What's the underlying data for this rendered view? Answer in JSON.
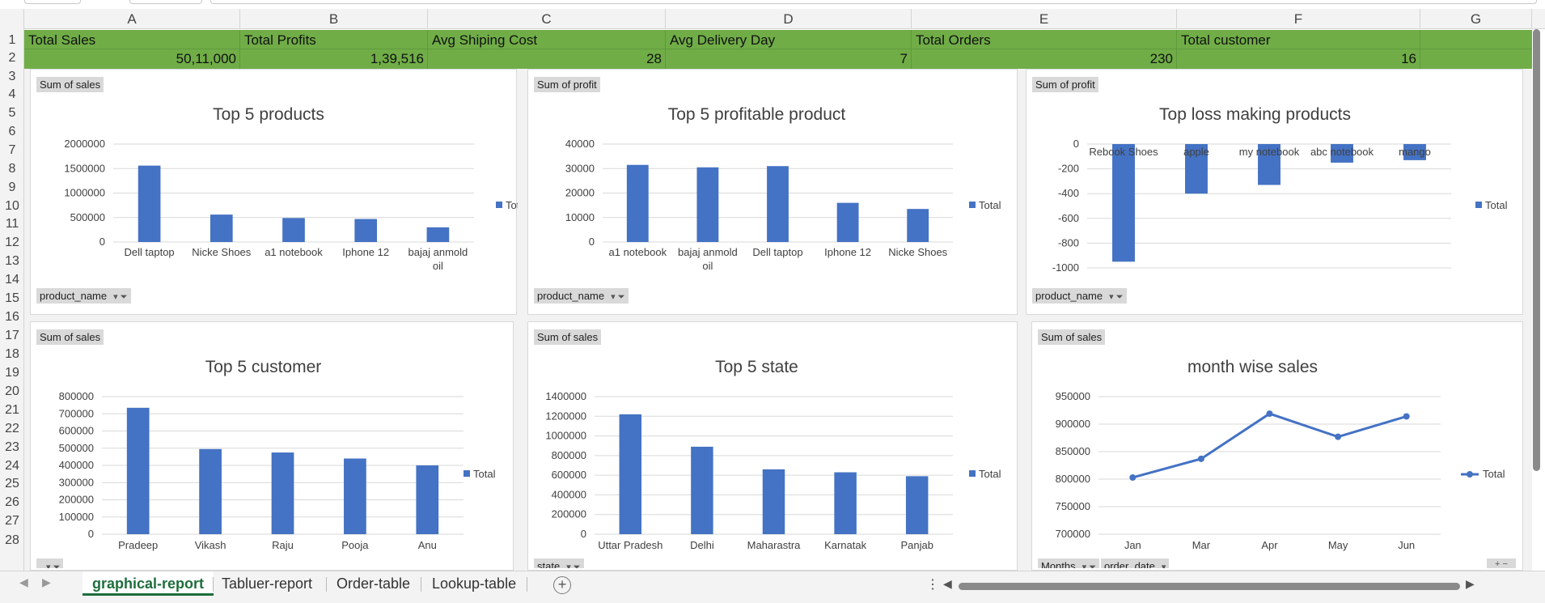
{
  "columns": [
    "A",
    "B",
    "C",
    "D",
    "E",
    "F",
    "G"
  ],
  "rows": [
    "1",
    "2",
    "3",
    "4",
    "5",
    "6",
    "7",
    "8",
    "9",
    "10",
    "11",
    "12",
    "13",
    "14",
    "15",
    "16",
    "17",
    "18",
    "19",
    "20",
    "21",
    "22",
    "23",
    "24",
    "25",
    "26",
    "27",
    "28"
  ],
  "kpis": [
    {
      "label": "Total Sales",
      "value": "50,11,000"
    },
    {
      "label": "Total Profits",
      "value": "1,39,516"
    },
    {
      "label": "Avg Shiping Cost",
      "value": "28"
    },
    {
      "label": "Avg Delivery Day",
      "value": "7"
    },
    {
      "label": "Total Orders",
      "value": "230"
    },
    {
      "label": "Total customer",
      "value": "16"
    }
  ],
  "chart_data": [
    {
      "type": "bar",
      "title": "Top 5 products",
      "field_tag": "Sum of sales",
      "filter_tag": "product_name",
      "legend": "Total",
      "categories": [
        "Dell taptop",
        "Nicke Shoes",
        "a1 notebook",
        "Iphone 12",
        "bajaj anmold oil"
      ],
      "values": [
        1560000,
        560000,
        490000,
        470000,
        300000
      ],
      "yticks": [
        "2000000",
        "1500000",
        "1000000",
        "500000",
        "0"
      ],
      "ylim": [
        0,
        2000000
      ]
    },
    {
      "type": "bar",
      "title": "Top 5 profitable product",
      "field_tag": "Sum of profit",
      "filter_tag": "product_name",
      "legend": "Total",
      "categories": [
        "a1 notebook",
        "bajaj anmold oil",
        "Dell taptop",
        "Iphone 12",
        "Nicke Shoes"
      ],
      "values": [
        31500,
        30500,
        31000,
        16000,
        13500
      ],
      "yticks": [
        "40000",
        "30000",
        "20000",
        "10000",
        "0"
      ],
      "ylim": [
        0,
        40000
      ]
    },
    {
      "type": "bar",
      "title": "Top loss making products",
      "field_tag": "Sum of profit",
      "filter_tag": "product_name",
      "legend": "Total",
      "categories": [
        "Rebook Shoes",
        "apple",
        "my notebook",
        "abc notebook",
        "mango"
      ],
      "values": [
        -950,
        -400,
        -330,
        -150,
        -130
      ],
      "yticks": [
        "0",
        "-200",
        "-400",
        "-600",
        "-800",
        "-1000"
      ],
      "ylim": [
        -1000,
        0
      ]
    },
    {
      "type": "bar",
      "title": "Top 5 customer",
      "field_tag": "Sum of sales",
      "filter_tag": "",
      "legend": "Total",
      "categories": [
        "Pradeep",
        "Vikash",
        "Raju",
        "Pooja",
        "Anu"
      ],
      "values": [
        735000,
        495000,
        475000,
        440000,
        400000
      ],
      "yticks": [
        "800000",
        "700000",
        "600000",
        "500000",
        "400000",
        "300000",
        "200000",
        "100000",
        "0"
      ],
      "ylim": [
        0,
        800000
      ]
    },
    {
      "type": "bar",
      "title": "Top 5 state",
      "field_tag": "Sum of sales",
      "filter_tag": "state",
      "legend": "Total",
      "categories": [
        "Uttar Pradesh",
        "Delhi",
        "Maharastra",
        "Karnatak",
        "Panjab"
      ],
      "values": [
        1220000,
        890000,
        660000,
        630000,
        590000
      ],
      "yticks": [
        "1400000",
        "1200000",
        "1000000",
        "800000",
        "600000",
        "400000",
        "200000",
        "0"
      ],
      "ylim": [
        0,
        1400000
      ]
    },
    {
      "type": "line",
      "title": "month wise sales",
      "field_tag": "Sum of sales",
      "filter_tag": "Months",
      "filter_tag2": "order_date",
      "legend": "Total",
      "categories": [
        "Jan",
        "Mar",
        "Apr",
        "May",
        "Jun"
      ],
      "values": [
        803000,
        837000,
        919000,
        877000,
        914000
      ],
      "yticks": [
        "950000",
        "900000",
        "850000",
        "800000",
        "750000",
        "700000"
      ],
      "ylim": [
        700000,
        950000
      ]
    }
  ],
  "tabs": [
    {
      "label": "graphical-report",
      "active": true
    },
    {
      "label": "Tabluer-report",
      "active": false
    },
    {
      "label": "Order-table",
      "active": false
    },
    {
      "label": "Lookup-table",
      "active": false
    }
  ],
  "colors": {
    "bar": "#4472c4",
    "kpi_band": "#70ad47",
    "active_tab": "#1e6e3c"
  }
}
